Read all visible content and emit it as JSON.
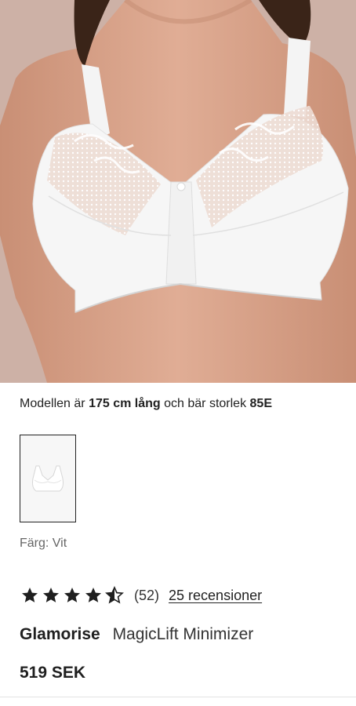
{
  "model_info": {
    "prefix": "Modellen är",
    "height": "175 cm lång",
    "middle": "och bär storlek",
    "size": "85E"
  },
  "color": {
    "label": "Färg: Vit",
    "swatch_color": "#ffffff"
  },
  "rating": {
    "stars": 4.5,
    "count_text": "(52)",
    "reviews_link": "25 recensioner"
  },
  "product": {
    "brand": "Glamorise",
    "name": "MagicLift Minimizer",
    "price": "519 SEK"
  },
  "icons": {
    "star": "star-icon",
    "half_star": "half-star-icon"
  },
  "colors": {
    "skin": "#d9a58e",
    "background": "#c9aea3",
    "text": "#1f1f1f",
    "star": "#1f1f1f"
  }
}
